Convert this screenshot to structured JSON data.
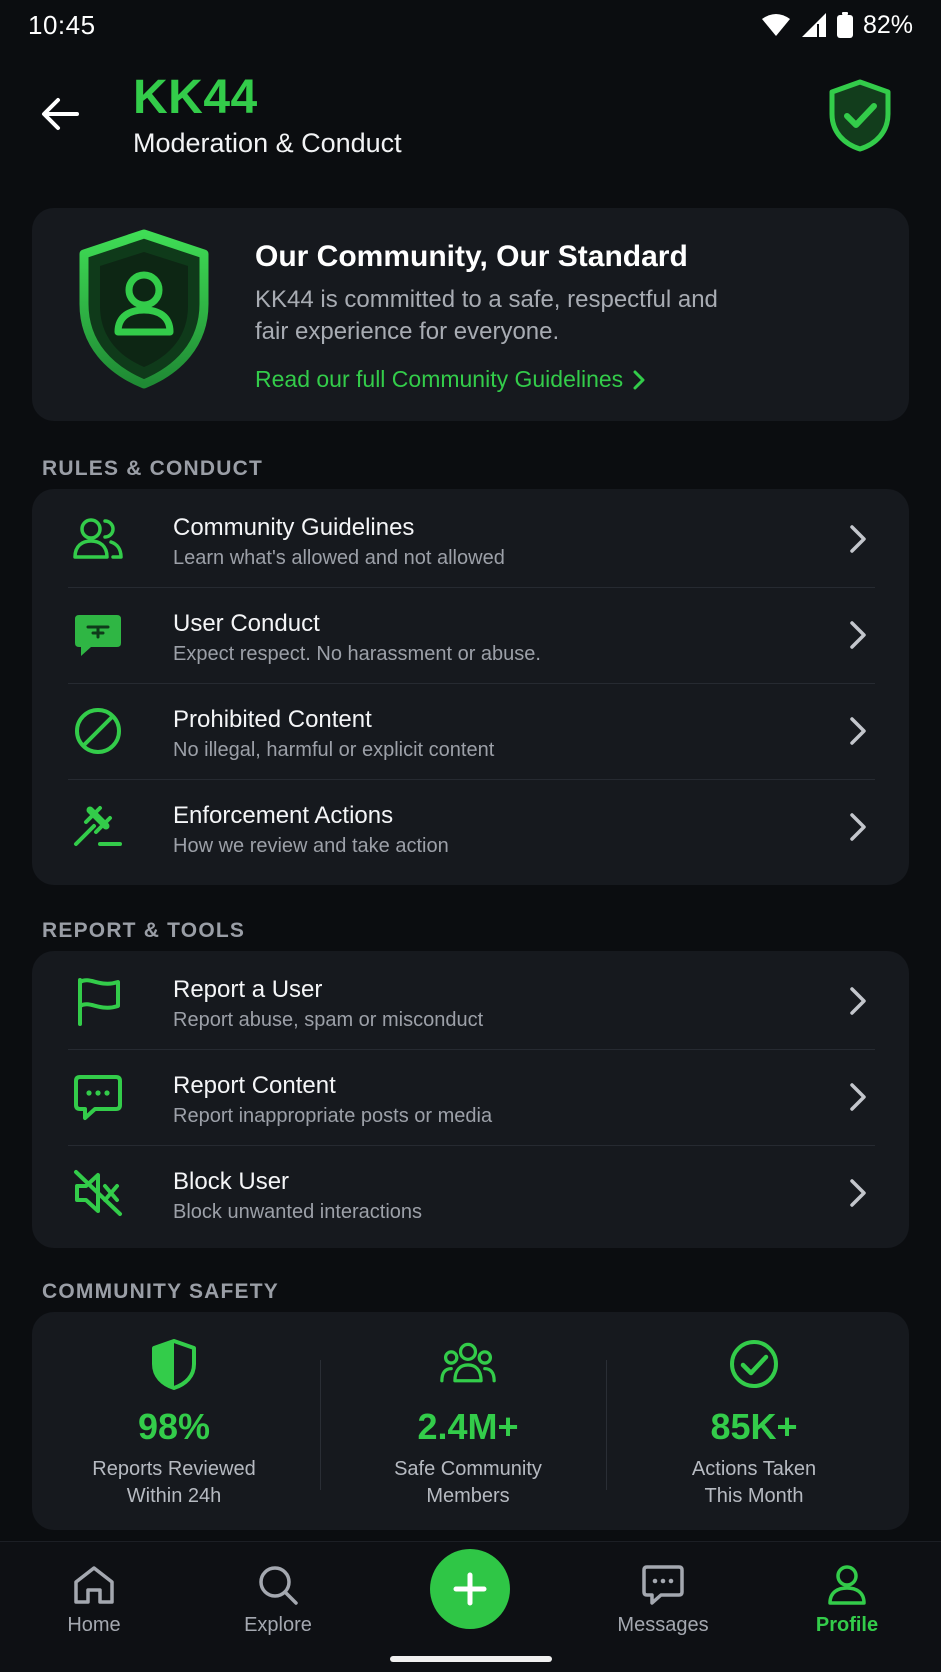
{
  "status": {
    "time": "10:45",
    "battery": "82%"
  },
  "header": {
    "title": "KK44",
    "subtitle": "Moderation & Conduct"
  },
  "hero": {
    "title": "Our Community, Our Standard",
    "description": "KK44 is committed to a safe, respectful and fair experience for everyone.",
    "link": "Read our full Community Guidelines"
  },
  "rules": {
    "label": "RULES & CONDUCT",
    "items": [
      {
        "title": "Community Guidelines",
        "subtitle": "Learn what's allowed and not allowed",
        "icon": "users-icon"
      },
      {
        "title": "User Conduct",
        "subtitle": "Expect respect. No harassment or abuse.",
        "icon": "chat-bubble-icon"
      },
      {
        "title": "Prohibited Content",
        "subtitle": "No illegal, harmful or explicit content",
        "icon": "prohibited-icon"
      },
      {
        "title": "Enforcement Actions",
        "subtitle": "How we review and take action",
        "icon": "gavel-icon"
      }
    ]
  },
  "tools": {
    "label": "REPORT & TOOLS",
    "items": [
      {
        "title": "Report a User",
        "subtitle": "Report abuse, spam or misconduct",
        "icon": "flag-icon"
      },
      {
        "title": "Report Content",
        "subtitle": "Report inappropriate posts or media",
        "icon": "message-icon"
      },
      {
        "title": "Block User",
        "subtitle": "Block unwanted interactions",
        "icon": "mute-icon"
      }
    ]
  },
  "safety": {
    "label": "COMMUNITY SAFETY",
    "stats": [
      {
        "value": "98%",
        "label_line1": "Reports Reviewed",
        "label_line2": "Within 24h",
        "icon": "shield-half-icon"
      },
      {
        "value": "2.4M+",
        "label_line1": "Safe Community",
        "label_line2": "Members",
        "icon": "group-icon"
      },
      {
        "value": "85K+",
        "label_line1": "Actions Taken",
        "label_line2": "This Month",
        "icon": "check-circle-icon"
      }
    ]
  },
  "nav": {
    "items": [
      {
        "label": "Home",
        "icon": "home-icon"
      },
      {
        "label": "Explore",
        "icon": "search-icon"
      },
      {
        "label": "Messages",
        "icon": "messages-icon"
      },
      {
        "label": "Profile",
        "icon": "profile-icon"
      }
    ],
    "fab_icon": "plus-icon",
    "active": "Profile"
  },
  "colors": {
    "accent": "#33cc4a",
    "background": "#0b0d10",
    "card": "#16191e"
  }
}
